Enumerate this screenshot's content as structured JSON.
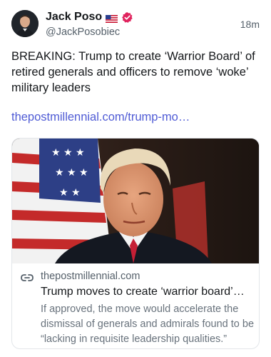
{
  "author": {
    "display_name": "Jack Poso",
    "handle": "@JackPosobiec",
    "flag_icon": "us-flag-icon",
    "verified_icon": "verified-badge-icon",
    "verified_color": "#e0245e"
  },
  "tweet": {
    "time_ago": "18m",
    "text": "BREAKING: Trump to create ‘Warrior Board’ of retired generals and officers to remove ‘woke’ military leaders",
    "link_text": "thepostmillennial.com/trump-mo…",
    "link_color": "#4f5bd5"
  },
  "card": {
    "icon": "link-icon",
    "domain": "thepostmillennial.com",
    "title": "Trump moves to create ‘warrior board’…",
    "description": "If approved, the move would accelerate the dismissal of generals and admirals found to be “lacking in requisite leadership qualities.”"
  }
}
